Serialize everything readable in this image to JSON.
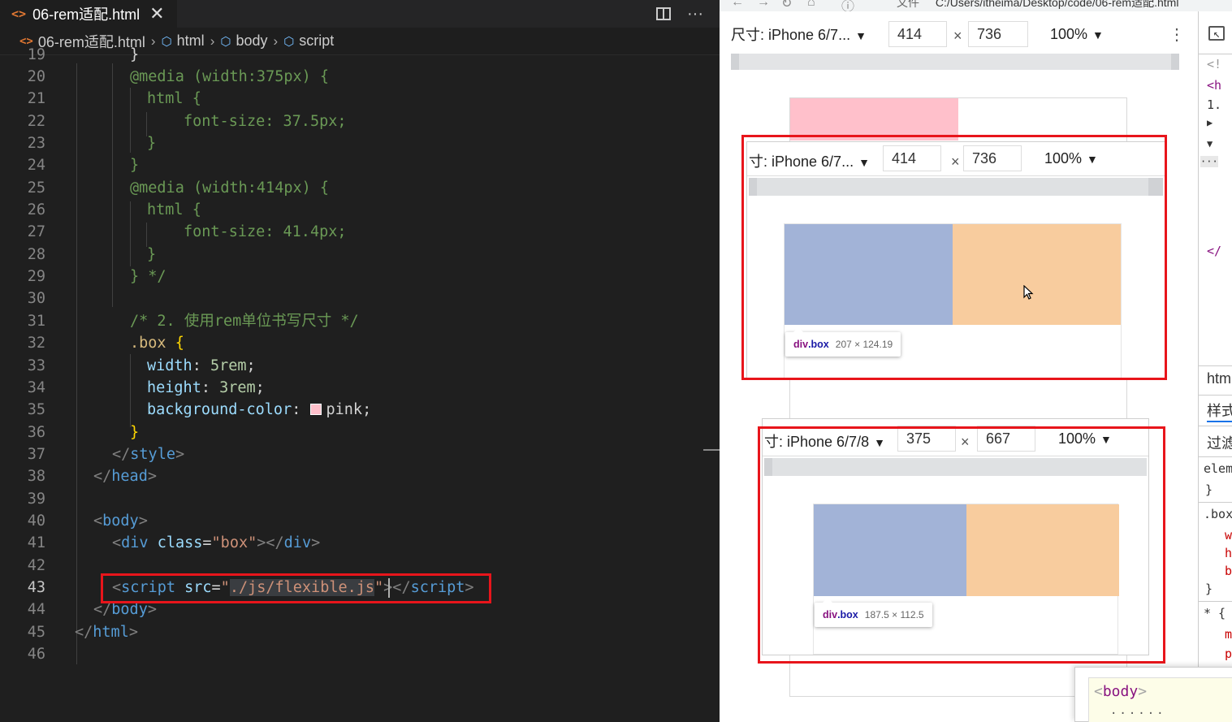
{
  "editor": {
    "tab": {
      "filename": "06-rem适配.html",
      "file_icon": "<>",
      "close_icon": "✕"
    },
    "tab_actions": {
      "split_icon": "split-editor-icon",
      "more": "···"
    },
    "breadcrumb": [
      {
        "label": "06-rem适配.html",
        "icon": "html-file-icon"
      },
      {
        "label": "html",
        "icon": "element-cube-icon"
      },
      {
        "label": "body",
        "icon": "element-cube-icon"
      },
      {
        "label": "script",
        "icon": "element-cube-icon"
      }
    ],
    "line_numbers": [
      "19",
      "20",
      "21",
      "22",
      "23",
      "24",
      "25",
      "26",
      "27",
      "28",
      "29",
      "30",
      "31",
      "32",
      "33",
      "34",
      "35",
      "36",
      "37",
      "38",
      "39",
      "40",
      "41",
      "42",
      "43",
      "44",
      "45",
      "46"
    ],
    "active_line": "43",
    "code": {
      "l19": "}",
      "l20_kw": "@media",
      "l20_rest": " (width:375px) {",
      "l21_sel": "html",
      "l21_rest": " {",
      "l22_prop": "font-size",
      "l22_val": "37.5px",
      "l23": "}",
      "l24": "}",
      "l25_kw": "@media",
      "l25_rest": " (width:414px) {",
      "l26_sel": "html",
      "l26_rest": " {",
      "l27_prop": "font-size",
      "l27_val": "41.4px",
      "l28": "}",
      "l29": "} */",
      "l31": "/* 2. 使用rem单位书写尺寸 */",
      "l32_sel": ".box",
      "l32_brace": "{",
      "l33_prop": "width",
      "l33_val": "5rem",
      "l34_prop": "height",
      "l34_val": "3rem",
      "l35_prop": "background-color",
      "l35_val": "pink",
      "l36": "}",
      "l37_tag": "style",
      "l38_tag": "head",
      "l40_tag": "body",
      "l41_tag": "div",
      "l41_attr": "class",
      "l41_val": "\"box\"",
      "l43_tag": "script",
      "l43_attr": "src",
      "l43_val_open": "\"",
      "l43_val": "./js/flexible.js",
      "l43_val_close": "\"",
      "l44_tag": "body",
      "l45_tag": "html"
    }
  },
  "browser": {
    "address": {
      "file_label": "文件",
      "path": "C:/Users/itheima/Desktop/code/06-rem适配.html"
    },
    "main_toolbar": {
      "device": "尺寸: iPhone 6/7...",
      "width": "414",
      "height": "736",
      "zoom": "100%",
      "more": "⋮"
    },
    "overlay_top": {
      "toolbar": {
        "device": "寸: iPhone 6/7...",
        "width": "414",
        "height": "736",
        "zoom": "100%"
      },
      "tooltip": {
        "element": "div",
        "class": ".box",
        "size": "207 × 124.19"
      }
    },
    "overlay_bottom": {
      "toolbar": {
        "device": "寸: iPhone 6/7/8",
        "width": "375",
        "height": "667",
        "zoom": "100%"
      },
      "tooltip": {
        "element": "div",
        "class": ".box",
        "size": "187.5 × 112.5"
      }
    },
    "times_sign": "×",
    "colors": {
      "box_blue": "#a2b3d7",
      "box_orange": "#f8cc9e",
      "pink": "#ffc0cb",
      "highlight_red": "#e8151b"
    },
    "devtools_strip": {
      "lines": [
        "<!",
        "<h",
        "1.",
        "▶",
        "▼",
        "···",
        "</",
        "htm",
        "样式",
        "过滤",
        "elem",
        "}",
        ".box",
        "w",
        "h",
        "b",
        "}",
        "* {",
        "m",
        "p"
      ],
      "body_tooltip": {
        "tag": "body",
        "dots": "......"
      }
    }
  }
}
